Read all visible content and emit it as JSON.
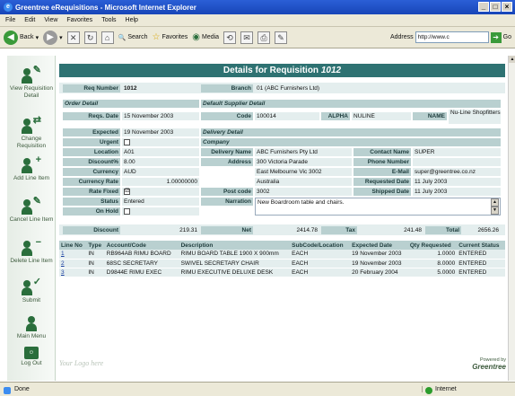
{
  "window": {
    "title": "Greentree eRequisitions - Microsoft Internet Explorer"
  },
  "menu": [
    "File",
    "Edit",
    "View",
    "Favorites",
    "Tools",
    "Help"
  ],
  "toolbar": {
    "back": "Back",
    "search": "Search",
    "favorites": "Favorites",
    "media": "Media",
    "address_label": "Address",
    "address_value": "http://www.c",
    "go": "Go"
  },
  "sidebar": [
    {
      "label": "View Requisition Detail",
      "icon": "view-requisition-icon"
    },
    {
      "label": "Change Requisition",
      "icon": "change-requisition-icon"
    },
    {
      "label": "Add Line Item",
      "icon": "add-line-item-icon"
    },
    {
      "label": "Cancel Line Item",
      "icon": "cancel-line-item-icon"
    },
    {
      "label": "Delete Line Item",
      "icon": "delete-line-item-icon"
    },
    {
      "label": "Submit",
      "icon": "submit-icon"
    },
    {
      "label": "Main Menu",
      "icon": "main-menu-icon"
    },
    {
      "label": "Log Out",
      "icon": "log-out-icon"
    }
  ],
  "header": {
    "prefix": "Details for Requisition",
    "number": "1012"
  },
  "req": {
    "number_label": "Req Number",
    "number": "1012",
    "branch_label": "Branch",
    "branch": "01 (ABC Furnishers Ltd)"
  },
  "sections": {
    "order_detail": "Order Detail",
    "supplier_detail": "Default Supplier Detail",
    "delivery_detail": "Delivery Detail",
    "company": "Company"
  },
  "order": {
    "req_date_label": "Reqs. Date",
    "req_date": "15 November 2003",
    "expected_label": "Expected",
    "expected": "19 November 2003",
    "urgent_label": "Urgent",
    "location_label": "Location",
    "location": "A01",
    "discount_pct_label": "Discount%",
    "discount_pct": "8.00",
    "currency_label": "Currency",
    "currency": "AUD",
    "currency_rate_label": "Currency Rate",
    "currency_rate": "1.00000000",
    "rate_fixed_label": "Rate Fixed",
    "rate_fixed": "☑",
    "status_label": "Status",
    "status": "Entered",
    "on_hold_label": "On Hold"
  },
  "supplier": {
    "code_label": "Code",
    "code": "100014",
    "alpha_label": "ALPHA",
    "alpha": "NULINE",
    "name_label": "NAME",
    "name": "Nu-Line Shopfitters"
  },
  "delivery": {
    "name_label": "Delivery Name",
    "name": "ABC Furnishers Pty Ltd",
    "address_label": "Address",
    "address1": "300 Victoria Parade",
    "address2": "East Melbourne Vic 3002",
    "address3": "Australia",
    "postcode_label": "Post code",
    "postcode": "3002",
    "narration_label": "Narration",
    "narration": "New Boardroom table and chairs.",
    "contact_label": "Contact Name",
    "contact": "SUPER",
    "phone_label": "Phone Number",
    "phone": "",
    "email_label": "E-Mail",
    "email": "super@greentree.co.nz",
    "requested_label": "Requested Date",
    "requested": "11 July 2003",
    "shipped_label": "Shipped Date",
    "shipped": "11 July 2003"
  },
  "totals": {
    "discount_label": "Discount",
    "discount": "219.31",
    "net_label": "Net",
    "net": "2414.78",
    "tax_label": "Tax",
    "tax": "241.48",
    "total_label": "Total",
    "total": "2656.26"
  },
  "table": {
    "headers": [
      "Line No",
      "Type",
      "Account/Code",
      "Description",
      "SubCode/Location",
      "Expected Date",
      "Qty Requested",
      "Current Status"
    ],
    "rows": [
      [
        "1",
        "IN",
        "RB964AB RIMU BOARD",
        "RIMU BOARD TABLE 1900 X 900mm",
        "EACH",
        "19 November 2003",
        "1.0000",
        "ENTERED"
      ],
      [
        "2",
        "IN",
        "68SC SECRETARY",
        "SWIVEL SECRETARY CHAIR",
        "EACH",
        "19 November 2003",
        "8.0000",
        "ENTERED"
      ],
      [
        "3",
        "IN",
        "D9844E RIMU EXEC",
        "RIMU EXECUTIVE DELUXE DESK",
        "EACH",
        "20 February 2004",
        "5.0000",
        "ENTERED"
      ]
    ]
  },
  "footer": {
    "your_logo": "Your Logo here",
    "powered_by": "Powered by",
    "brand": "Greentree"
  },
  "status": {
    "left": "Done",
    "zone": "Internet"
  }
}
